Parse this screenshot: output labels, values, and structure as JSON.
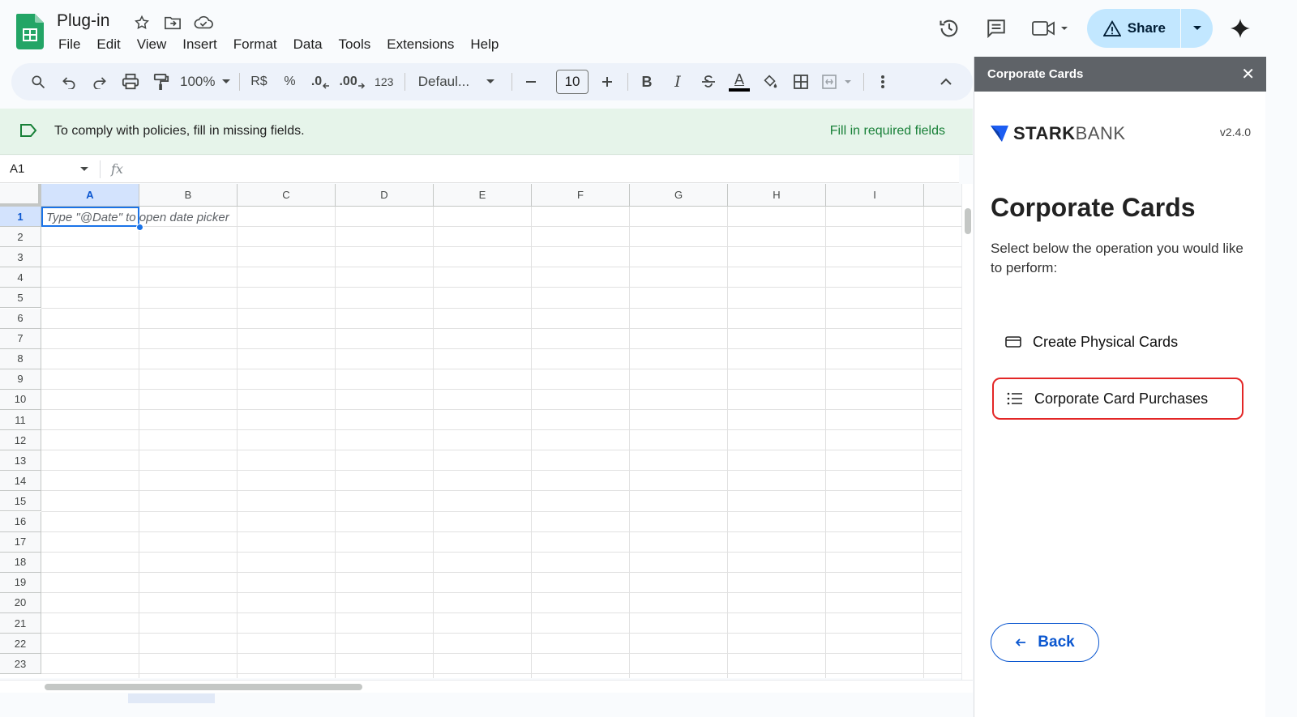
{
  "doc": {
    "title": "Plug-in"
  },
  "menu": [
    "File",
    "Edit",
    "View",
    "Insert",
    "Format",
    "Data",
    "Tools",
    "Extensions",
    "Help"
  ],
  "share": {
    "label": "Share"
  },
  "toolbar": {
    "zoom": "100%",
    "currency": "R$",
    "percent": "%",
    "dec_decrease": ".0",
    "dec_increase": ".00",
    "number_format": "123",
    "font": "Defaul...",
    "font_size": "10",
    "bold": "B",
    "italic": "I",
    "text_color": "A"
  },
  "banner": {
    "text": "To comply with policies, fill in missing fields.",
    "link": "Fill in required fields"
  },
  "formula": {
    "name_box": "A1",
    "fx": "fx"
  },
  "grid": {
    "columns": [
      "A",
      "B",
      "C",
      "D",
      "E",
      "F",
      "G",
      "H",
      "I"
    ],
    "rows": [
      "1",
      "2",
      "3",
      "4",
      "5",
      "6",
      "7",
      "8",
      "9",
      "10",
      "11",
      "12",
      "13",
      "14",
      "15",
      "16",
      "17",
      "18",
      "19",
      "20",
      "21",
      "22",
      "23"
    ],
    "selected_cell_placeholder": "Type \"@Date\" to open date picker"
  },
  "panel": {
    "header": "Corporate Cards",
    "brand_left": "STARK",
    "brand_right": "BANK",
    "version": "v2.4.0",
    "heading": "Corporate Cards",
    "description": "Select below the operation you would like to perform:",
    "op_create": "Create Physical Cards",
    "op_purchases": "Corporate Card Purchases",
    "back": "Back"
  },
  "colors": {
    "accent": "#0b57d0",
    "highlight": "#e32626",
    "banner_bg": "#e6f4ea",
    "sheets_green": "#188038"
  }
}
